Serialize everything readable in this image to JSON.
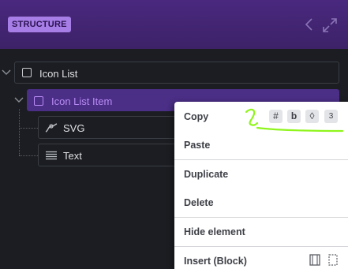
{
  "header": {
    "badge": "STRUCTURE",
    "icons": [
      "chevron-left-icon",
      "expand-icon"
    ]
  },
  "tree": {
    "items": [
      {
        "label": "Icon List",
        "icon": "checkbox-icon",
        "expanded": true
      },
      {
        "label": "Icon List Item",
        "icon": "checkbox-icon",
        "expanded": true,
        "selected": true
      },
      {
        "label": "SVG",
        "icon": "svg-icon"
      },
      {
        "label": "Text",
        "icon": "text-lines-icon"
      }
    ]
  },
  "context_menu": {
    "items": [
      "Copy",
      "Paste",
      "Duplicate",
      "Delete",
      "Hide element",
      "Insert (Block)"
    ],
    "copy_icons": [
      {
        "name": "hash-icon",
        "glyph": "#"
      },
      {
        "name": "bold-b-icon",
        "glyph": "b"
      },
      {
        "name": "drop-icon",
        "glyph": "◊"
      },
      {
        "name": "css3-icon",
        "glyph": "3"
      }
    ],
    "insert_icons": [
      "block-icon",
      "box-icon"
    ]
  },
  "colors": {
    "header_purple": "#49287e",
    "badge": "#a77ee6",
    "selected_bg": "#4b2e86",
    "selected_text": "#b88cf5",
    "annotation_green": "#8ff51c"
  }
}
